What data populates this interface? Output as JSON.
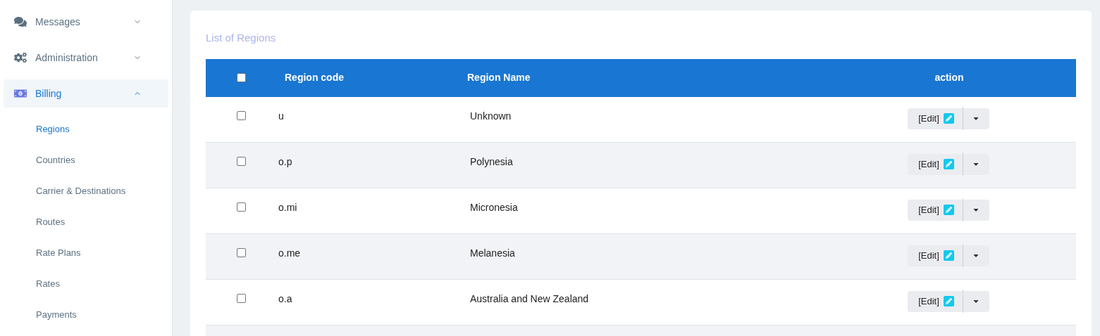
{
  "sidebar": {
    "items": [
      {
        "label": "Messages",
        "expanded": false,
        "selected": false
      },
      {
        "label": "Administration",
        "expanded": false,
        "selected": false
      },
      {
        "label": "Billing",
        "expanded": true,
        "selected": true,
        "children": [
          {
            "label": "Regions",
            "selected": true
          },
          {
            "label": "Countries",
            "selected": false
          },
          {
            "label": "Carrier & Destinations",
            "selected": false
          },
          {
            "label": "Routes",
            "selected": false
          },
          {
            "label": "Rate Plans",
            "selected": false
          },
          {
            "label": "Rates",
            "selected": false
          },
          {
            "label": "Payments",
            "selected": false
          }
        ]
      }
    ]
  },
  "card": {
    "title": "List of Regions",
    "table": {
      "select_all_checked": false,
      "columns": [
        "Region code",
        "Region Name",
        "action"
      ],
      "rows": [
        {
          "checked": false,
          "code": "u",
          "name": "Unknown",
          "action": "[Edit]"
        },
        {
          "checked": false,
          "code": "o.p",
          "name": "Polynesia",
          "action": "[Edit]"
        },
        {
          "checked": false,
          "code": "o.mi",
          "name": "Micronesia",
          "action": "[Edit]"
        },
        {
          "checked": false,
          "code": "o.me",
          "name": "Melanesia",
          "action": "[Edit]"
        },
        {
          "checked": false,
          "code": "o.a",
          "name": "Australia and New Zealand",
          "action": "[Edit]"
        }
      ]
    }
  }
}
